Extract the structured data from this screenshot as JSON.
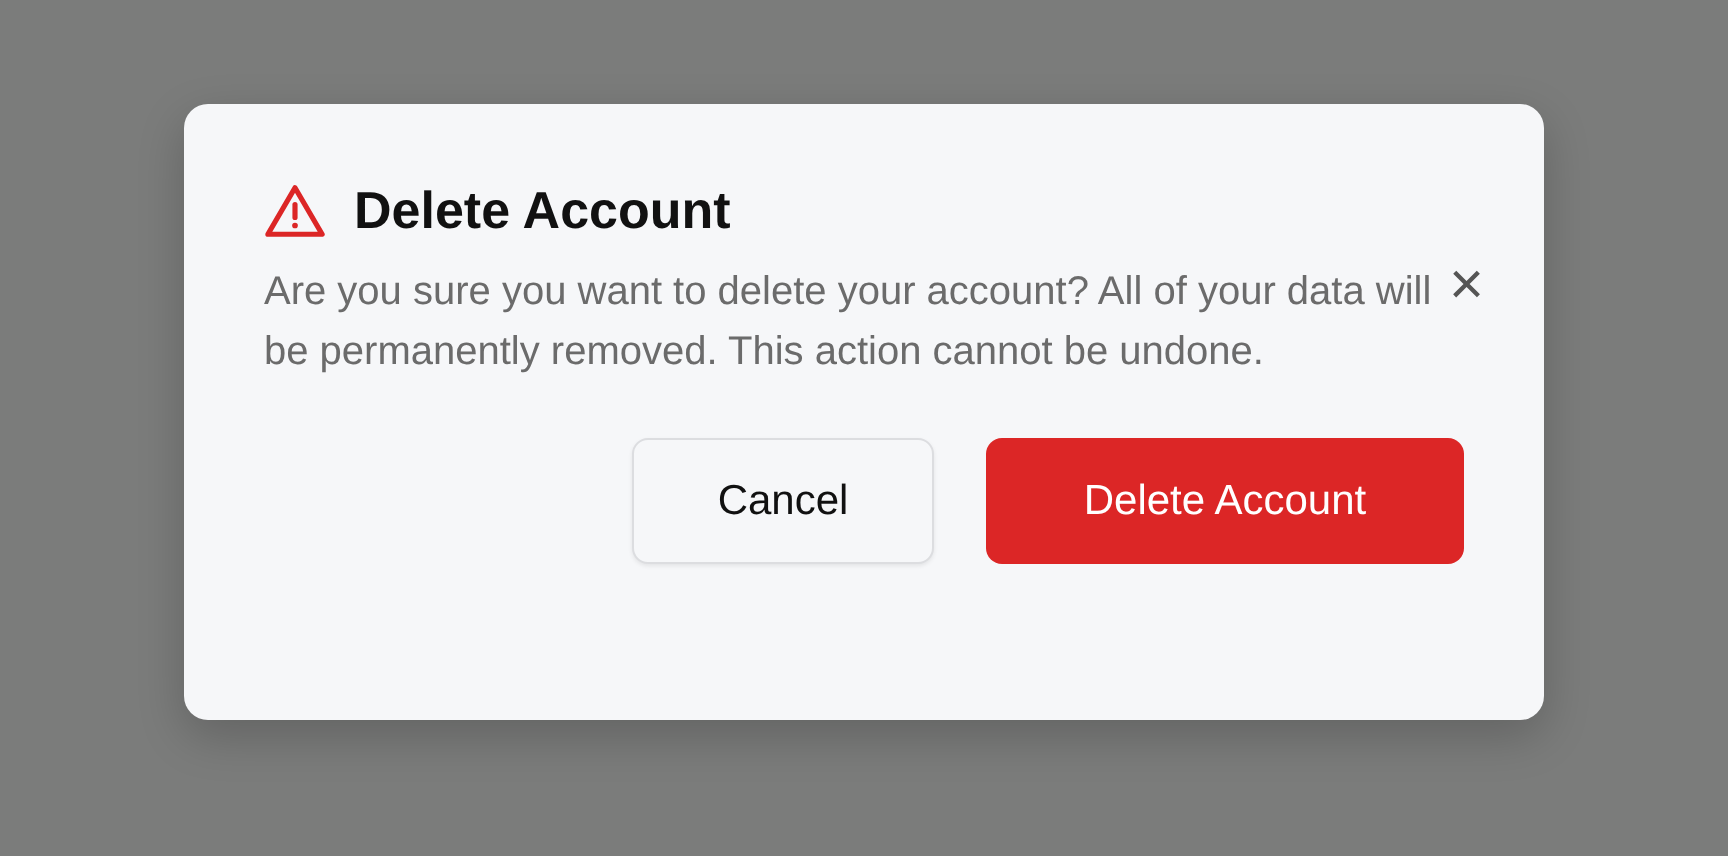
{
  "dialog": {
    "title": "Delete Account",
    "message": "Are you sure you want to delete your account? All of your data will be permanently removed. This action cannot be undone.",
    "close": "×",
    "buttons": [
      {
        "label": "Cancel",
        "kind": "secondary"
      },
      {
        "label": "Delete Account",
        "kind": "danger"
      }
    ]
  }
}
